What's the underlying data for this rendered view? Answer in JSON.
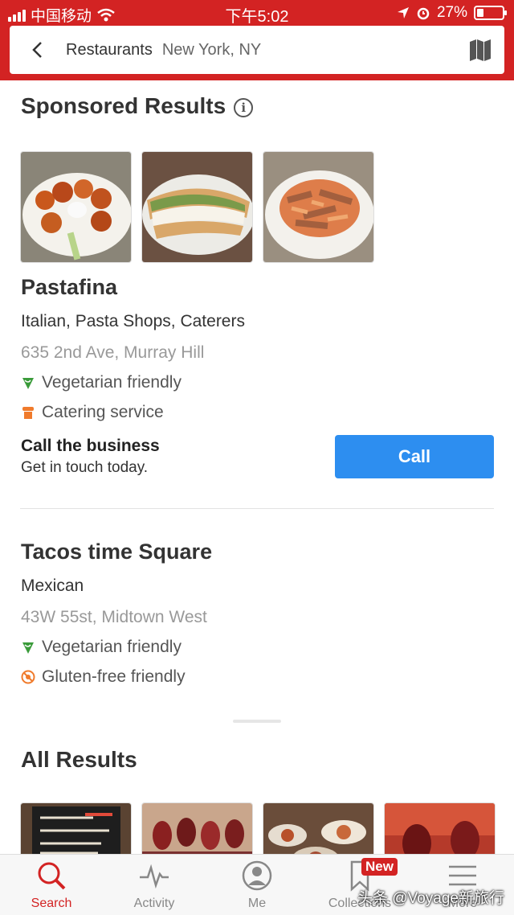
{
  "status": {
    "carrier": "中国移动",
    "time": "下午5:02",
    "battery": "27%",
    "battery_level": 0.27
  },
  "header": {
    "search_term": "Restaurants",
    "location": "New York, NY",
    "icons": [
      "chevron-left-icon",
      "map-icon"
    ]
  },
  "sponsored": {
    "title": "Sponsored Results",
    "business": {
      "name": "Pastafina",
      "categories": "Italian, Pasta Shops, Caterers",
      "address": "635 2nd Ave, Murray Hill",
      "amenities": [
        {
          "label": "Vegetarian friendly",
          "icon": "vegetarian-icon",
          "color": "#3a9b3a"
        },
        {
          "label": "Catering service",
          "icon": "catering-icon",
          "color": "#f07b2c"
        }
      ],
      "cta_title": "Call the business",
      "cta_subtitle": "Get in touch today.",
      "call_label": "Call"
    }
  },
  "second_business": {
    "name": "Tacos time Square",
    "categories": "Mexican",
    "address": "43W 55st, Midtown West",
    "amenities": [
      {
        "label": "Vegetarian friendly",
        "icon": "vegetarian-icon",
        "color": "#3a9b3a"
      },
      {
        "label": "Gluten-free friendly",
        "icon": "gluten-free-icon",
        "color": "#f07b2c"
      }
    ]
  },
  "all_results": {
    "title": "All Results"
  },
  "tabs": [
    {
      "label": "Search",
      "icon": "search-icon",
      "active": true
    },
    {
      "label": "Activity",
      "icon": "activity-icon",
      "active": false
    },
    {
      "label": "Me",
      "icon": "profile-icon",
      "active": false
    },
    {
      "label": "Collections",
      "icon": "bookmark-icon",
      "active": false,
      "badge": "New"
    },
    {
      "label": "More",
      "icon": "menu-icon",
      "active": false
    }
  ],
  "watermark": "头条 @Voyage新旅行",
  "colors": {
    "brand_red": "#d32323",
    "call_blue": "#2d8ef0"
  }
}
